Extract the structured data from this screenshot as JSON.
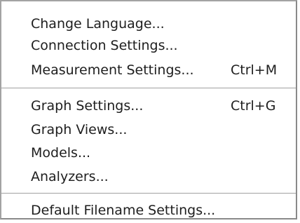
{
  "menu": {
    "items": [
      {
        "label": "Change Language...",
        "shortcut": ""
      },
      {
        "label": "Connection Settings...",
        "shortcut": ""
      },
      {
        "label": "Measurement Settings...",
        "shortcut": "Ctrl+M"
      },
      {
        "label": "Graph Settings...",
        "shortcut": "Ctrl+G"
      },
      {
        "label": "Graph Views...",
        "shortcut": ""
      },
      {
        "label": "Models...",
        "shortcut": ""
      },
      {
        "label": "Analyzers...",
        "shortcut": ""
      },
      {
        "label": "Default Filename Settings...",
        "shortcut": ""
      }
    ]
  }
}
